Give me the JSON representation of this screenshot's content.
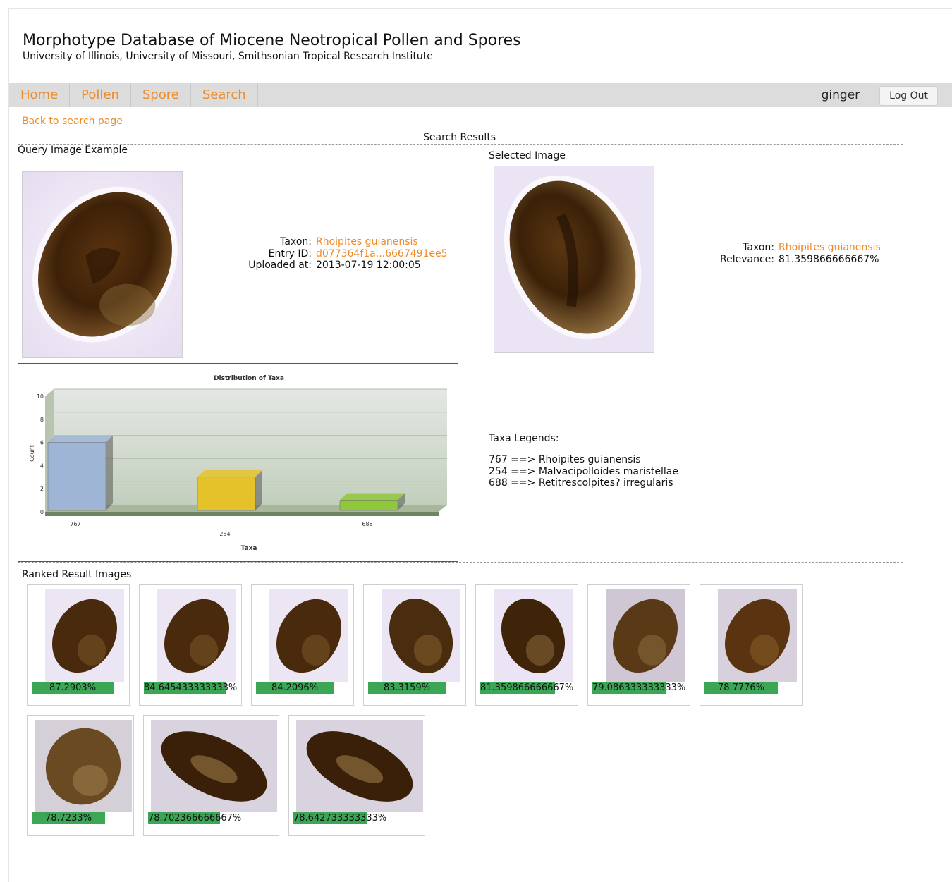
{
  "site": {
    "title": "Morphotype Database of Miocene Neotropical Pollen and Spores",
    "subtitle": "University of Illinois, University of Missouri, Smithsonian Tropical Research Institute"
  },
  "nav": {
    "items": [
      "Home",
      "Pollen",
      "Spore",
      "Search"
    ],
    "username": "ginger",
    "logout_label": "Log Out"
  },
  "back_link": "Back to search page",
  "results_heading": "Search Results",
  "query": {
    "label": "Query Image Example",
    "taxon_label": "Taxon:",
    "taxon": "Rhoipites guianensis",
    "entry_id_label": "Entry ID:",
    "entry_id": "d077364f1a...6667491ee5",
    "uploaded_label": "Uploaded at:",
    "uploaded": "2013-07-19 12:00:05"
  },
  "selected": {
    "label": "Selected Image",
    "taxon_label": "Taxon:",
    "taxon": "Rhoipites guianensis",
    "relevance_label": "Relevance:",
    "relevance": "81.359866666667%"
  },
  "legend": {
    "title": "Taxa Legends:",
    "rows": [
      "767 ==> Rhoipites guianensis",
      "254 ==> Malvacipolloides maristellae",
      "688 ==> Retitrescolpites? irregularis"
    ]
  },
  "ranked": {
    "label": "Ranked Result Images",
    "items": [
      {
        "pct": "87.2903%",
        "score": 87.2903
      },
      {
        "pct": "84.645433333333%",
        "score": 84.645433333333
      },
      {
        "pct": "84.2096%",
        "score": 84.2096
      },
      {
        "pct": "83.3159%",
        "score": 83.3159
      },
      {
        "pct": "81.359866666667%",
        "score": 81.359866666667
      },
      {
        "pct": "79.086333333333%",
        "score": 79.086333333333
      },
      {
        "pct": "78.7776%",
        "score": 78.7776
      },
      {
        "pct": "78.7233%",
        "score": 78.7233
      },
      {
        "pct": "78.702366666667%",
        "score": 78.702366666667
      },
      {
        "pct": "78.642733333333%",
        "score": 78.642733333333
      }
    ]
  },
  "chart_data": {
    "type": "bar",
    "title": "Distribution of Taxa",
    "xlabel": "Taxa",
    "ylabel": "Count",
    "categories": [
      "767",
      "254",
      "688"
    ],
    "values": [
      6,
      3,
      1
    ],
    "ylim": [
      0,
      10
    ],
    "yticks": [
      0,
      2,
      4,
      6,
      8,
      10
    ],
    "colors": [
      "#9fb5d6",
      "#e6c22a",
      "#8fc83a"
    ],
    "grid": true
  }
}
